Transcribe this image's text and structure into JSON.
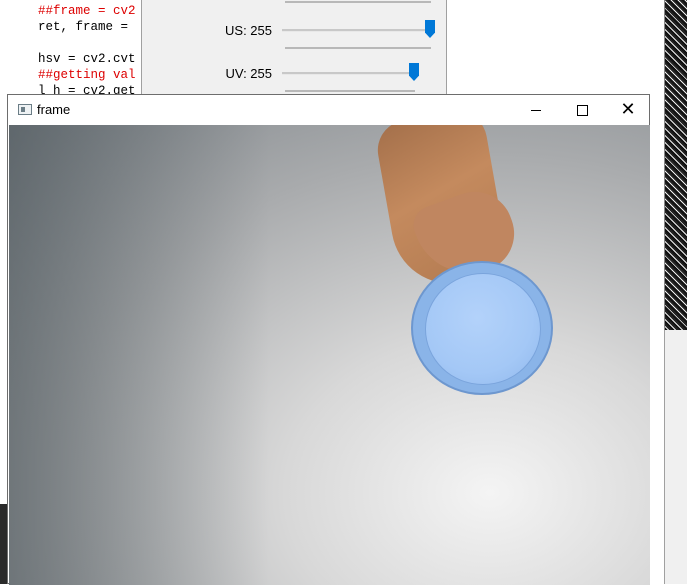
{
  "code_editor": {
    "lines": [
      {
        "text": "##frame = cv2",
        "kind": "comment"
      },
      {
        "text": "ret, frame = ",
        "kind": "normal"
      },
      {
        "text": "",
        "kind": "normal"
      },
      {
        "text": "hsv = cv2.cvt",
        "kind": "normal"
      },
      {
        "text": "##getting val",
        "kind": "comment"
      },
      {
        "text": "l_h = cv2.get",
        "kind": "normal"
      }
    ]
  },
  "trackbars": [
    {
      "label": "US: 255",
      "value": 255,
      "max": 255
    },
    {
      "label": "UV: 255",
      "value": 255,
      "max": 255
    }
  ],
  "frame_window": {
    "title": "frame",
    "icon": "app-window-icon",
    "controls": {
      "minimize": "minimize-icon",
      "maximize": "maximize-icon",
      "close": "close-icon"
    }
  },
  "colors": {
    "thumb": "#0078d7",
    "comment": "#dd0000",
    "disc": "#a4c8f6"
  }
}
